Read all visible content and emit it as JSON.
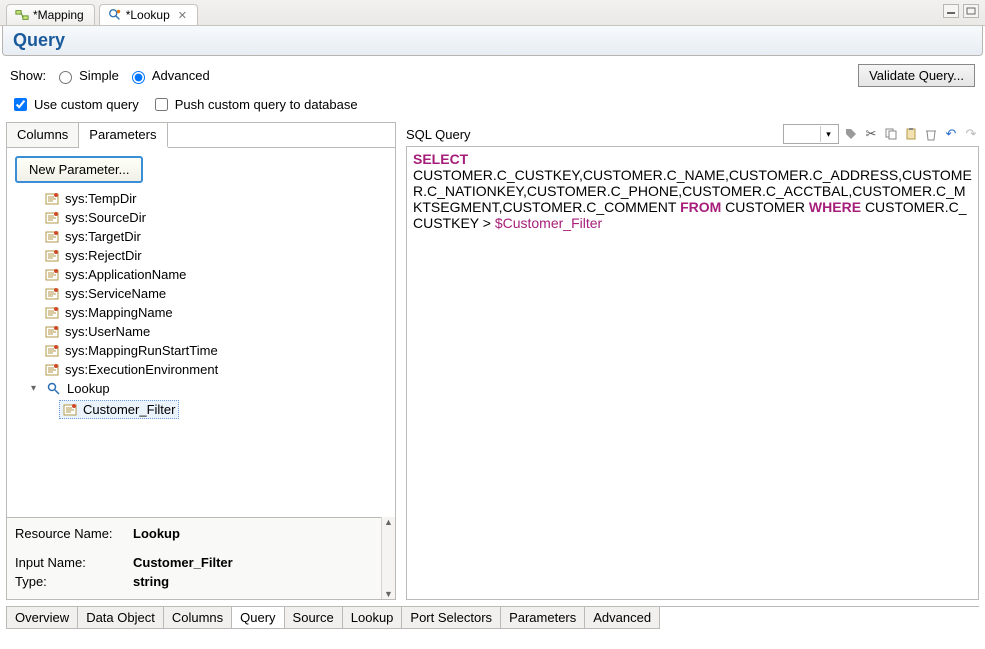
{
  "editor_tabs": {
    "mapping_label": "*Mapping",
    "lookup_label": "*Lookup"
  },
  "header": {
    "title": "Query"
  },
  "show_row": {
    "show_label": "Show:",
    "simple_label": "Simple",
    "advanced_label": "Advanced",
    "validate_button": "Validate Query..."
  },
  "options": {
    "use_custom_label": "Use custom query",
    "push_label": "Push custom query to database"
  },
  "left": {
    "tab_columns": "Columns",
    "tab_parameters": "Parameters",
    "new_param_button": "New Parameter...",
    "items": [
      "sys:TempDir",
      "sys:SourceDir",
      "sys:TargetDir",
      "sys:RejectDir",
      "sys:ApplicationName",
      "sys:ServiceName",
      "sys:MappingName",
      "sys:UserName",
      "sys:MappingRunStartTime",
      "sys:ExecutionEnvironment"
    ],
    "lookup_node": "Lookup",
    "lookup_child": "Customer_Filter",
    "details": {
      "resource_name_label": "Resource Name:",
      "resource_name_value": "Lookup",
      "input_name_label": "Input Name:",
      "input_name_value": "Customer_Filter",
      "type_label": "Type:",
      "type_value": "string"
    }
  },
  "right": {
    "label": "SQL Query",
    "sql_kw_select": "SELECT",
    "sql_body1": "CUSTOMER.C_CUSTKEY,CUSTOMER.C_NAME,CUSTOMER.C_ADDRESS,CUSTOMER.C_NATIONKEY,CUSTOMER.C_PHONE,CUSTOMER.C_ACCTBAL,CUSTOMER.C_MKTSEGMENT,CUSTOMER.C_COMMENT ",
    "sql_kw_from": "FROM",
    "sql_body2": " CUSTOMER ",
    "sql_kw_where": "WHERE",
    "sql_body3": " CUSTOMER.C_CUSTKEY > ",
    "sql_param": "$Customer_Filter"
  },
  "bottom_tabs": [
    "Overview",
    "Data Object",
    "Columns",
    "Query",
    "Source",
    "Lookup",
    "Port Selectors",
    "Parameters",
    "Advanced"
  ],
  "bottom_active_index": 3
}
